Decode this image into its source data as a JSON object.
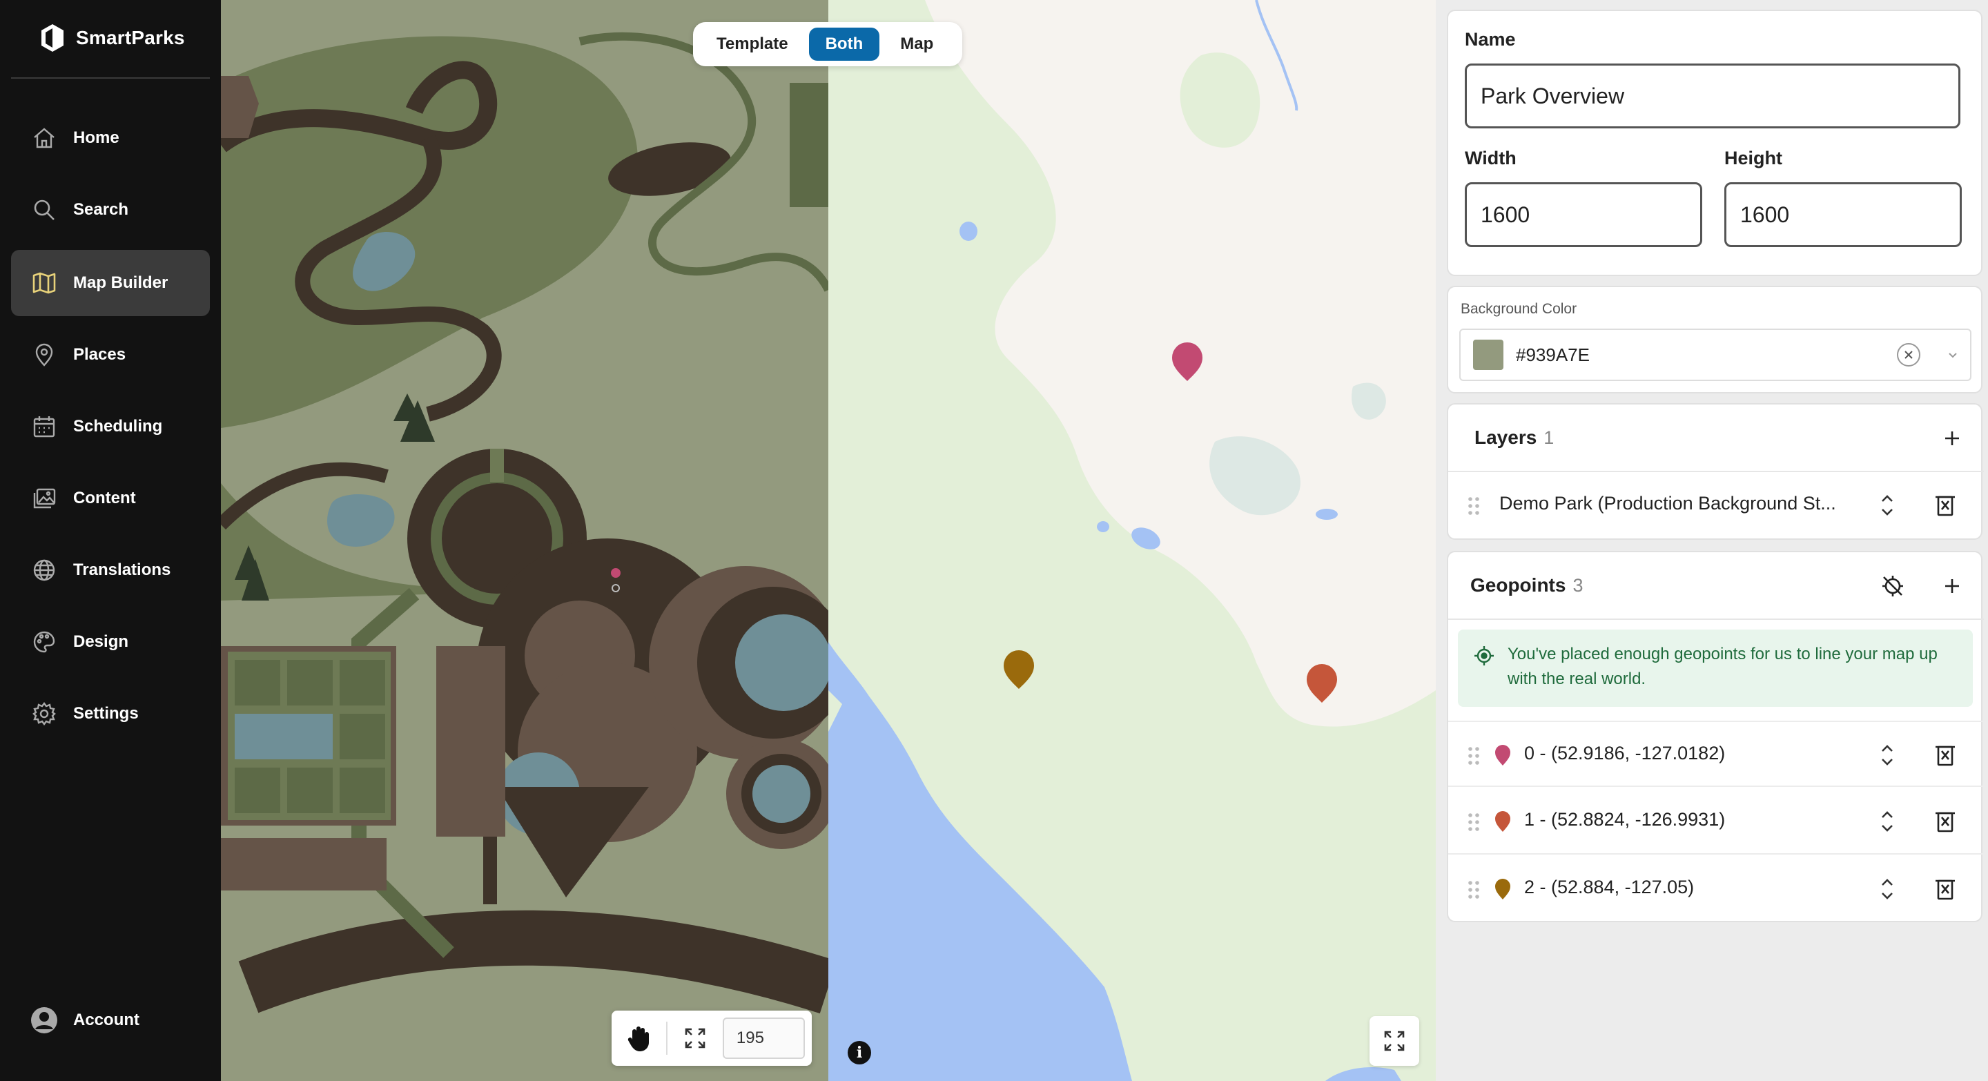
{
  "brand": {
    "name": "SmartParks"
  },
  "nav": {
    "items": [
      {
        "label": "Home",
        "icon": "home-icon",
        "active": false
      },
      {
        "label": "Search",
        "icon": "search-icon",
        "active": false
      },
      {
        "label": "Map Builder",
        "icon": "map-icon",
        "active": true
      },
      {
        "label": "Places",
        "icon": "pin-icon",
        "active": false
      },
      {
        "label": "Scheduling",
        "icon": "calendar-icon",
        "active": false
      },
      {
        "label": "Content",
        "icon": "images-icon",
        "active": false
      },
      {
        "label": "Translations",
        "icon": "globe-icon",
        "active": false
      },
      {
        "label": "Design",
        "icon": "palette-icon",
        "active": false
      },
      {
        "label": "Settings",
        "icon": "gear-icon",
        "active": false
      }
    ],
    "account_label": "Account"
  },
  "mode_toggle": {
    "options": [
      "Template",
      "Both",
      "Map"
    ],
    "selected": "Both"
  },
  "canvas_tools": {
    "zoom_value": "195"
  },
  "panel": {
    "name_label": "Name",
    "name_value": "Park Overview",
    "width_label": "Width",
    "width_value": "1600",
    "height_label": "Height",
    "height_value": "1600",
    "background_color_label": "Background Color",
    "background_color_value": "#939A7E",
    "layers": {
      "title": "Layers",
      "count": "1",
      "items": [
        {
          "label": "Demo Park (Production Background St..."
        }
      ]
    },
    "geopoints": {
      "title": "Geopoints",
      "count": "3",
      "alert": "You've placed enough geopoints for us to line your map up with the real world.",
      "items": [
        {
          "label": "0 - (52.9186, -127.0182)",
          "color": "#c24a72"
        },
        {
          "label": "1 - (52.8824, -126.9931)",
          "color": "#c5563a"
        },
        {
          "label": "2 - (52.884, -127.05)",
          "color": "#9a6a0c"
        }
      ]
    }
  },
  "colors": {
    "accent": "#0b69a9",
    "template_bg": "#939A7E",
    "sidebar_bg": "#121212",
    "map_land": "#e3efd8",
    "map_water": "#a4c2f4",
    "map_light": "#f6f3ef"
  }
}
